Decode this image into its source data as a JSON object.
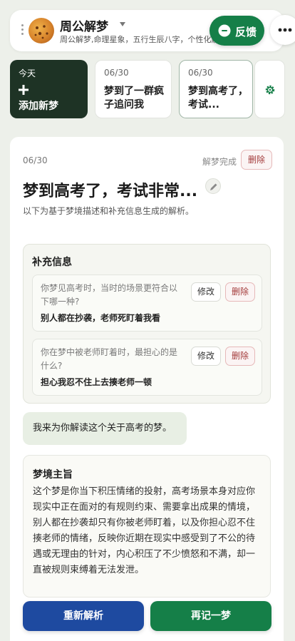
{
  "header": {
    "title": "周公解梦",
    "subtitle": "周公解梦,命理星象，五行生辰八字，个性化解梦，破...",
    "feedback_label": "反馈"
  },
  "dream_cards": {
    "new_card": {
      "top_label": "今天",
      "action_label": "添加新梦"
    },
    "items": [
      {
        "date": "06/30",
        "title": "梦到了一群疯子追问我"
      },
      {
        "date": "06/30",
        "title": "梦到高考了，考试..."
      }
    ]
  },
  "detail": {
    "date": "06/30",
    "status": "解梦完成",
    "delete_label": "删除",
    "title": "梦到高考了，考试非常...",
    "description": "以下为基于梦境描述和补充信息生成的解析。",
    "supplement": {
      "title": "补充信息",
      "edit_label": "修改",
      "delete_label": "删除",
      "items": [
        {
          "question": "你梦见高考时，当时的场景更符合以下哪一种?",
          "answer": "别人都在抄袭，老师死盯着我看"
        },
        {
          "question": "你在梦中被老师盯着时，最担心的是什么?",
          "answer": "担心我忍不住上去揍老师一顿"
        }
      ]
    },
    "intro_message": "我来为你解读这个关于高考的梦。",
    "theme": {
      "title": "梦境主旨",
      "body": "这个梦是你当下积压情绪的投射，高考场景本身对应你现实中正在面对的有规则约束、需要拿出成果的情境，别人都在抄袭却只有你被老师盯着，以及你担心忍不住揍老师的情绪，反映你近期在现实中感受到了不公的待遇或无理由的针对，内心积压了不少愤怒和不满，却一直被规则束缚着无法发泄。"
    }
  },
  "actions": {
    "reparse_label": "重新解析",
    "record_again_label": "再记一梦"
  },
  "colors": {
    "primary_green": "#157f48",
    "dark_green": "#1e3325",
    "primary_blue": "#1e4aa0",
    "danger_red": "#a33b3b"
  }
}
